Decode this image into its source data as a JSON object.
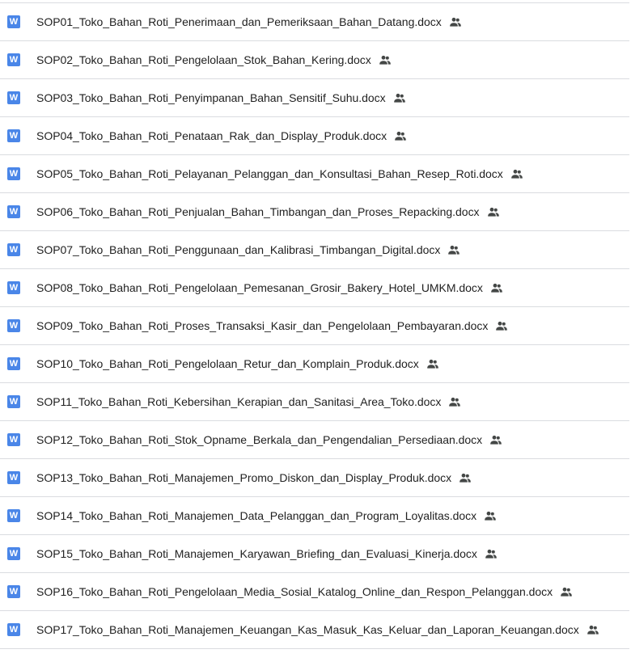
{
  "files": [
    {
      "name": "SOP01_Toko_Bahan_Roti_Penerimaan_dan_Pemeriksaan_Bahan_Datang.docx",
      "file_type_icon": "word-doc-icon",
      "shared_icon": "people-icon"
    },
    {
      "name": "SOP02_Toko_Bahan_Roti_Pengelolaan_Stok_Bahan_Kering.docx",
      "file_type_icon": "word-doc-icon",
      "shared_icon": "people-icon"
    },
    {
      "name": "SOP03_Toko_Bahan_Roti_Penyimpanan_Bahan_Sensitif_Suhu.docx",
      "file_type_icon": "word-doc-icon",
      "shared_icon": "people-icon"
    },
    {
      "name": "SOP04_Toko_Bahan_Roti_Penataan_Rak_dan_Display_Produk.docx",
      "file_type_icon": "word-doc-icon",
      "shared_icon": "people-icon"
    },
    {
      "name": "SOP05_Toko_Bahan_Roti_Pelayanan_Pelanggan_dan_Konsultasi_Bahan_Resep_Roti.docx",
      "file_type_icon": "word-doc-icon",
      "shared_icon": "people-icon"
    },
    {
      "name": "SOP06_Toko_Bahan_Roti_Penjualan_Bahan_Timbangan_dan_Proses_Repacking.docx",
      "file_type_icon": "word-doc-icon",
      "shared_icon": "people-icon"
    },
    {
      "name": "SOP07_Toko_Bahan_Roti_Penggunaan_dan_Kalibrasi_Timbangan_Digital.docx",
      "file_type_icon": "word-doc-icon",
      "shared_icon": "people-icon"
    },
    {
      "name": "SOP08_Toko_Bahan_Roti_Pengelolaan_Pemesanan_Grosir_Bakery_Hotel_UMKM.docx",
      "file_type_icon": "word-doc-icon",
      "shared_icon": "people-icon"
    },
    {
      "name": "SOP09_Toko_Bahan_Roti_Proses_Transaksi_Kasir_dan_Pengelolaan_Pembayaran.docx",
      "file_type_icon": "word-doc-icon",
      "shared_icon": "people-icon"
    },
    {
      "name": "SOP10_Toko_Bahan_Roti_Pengelolaan_Retur_dan_Komplain_Produk.docx",
      "file_type_icon": "word-doc-icon",
      "shared_icon": "people-icon"
    },
    {
      "name": "SOP11_Toko_Bahan_Roti_Kebersihan_Kerapian_dan_Sanitasi_Area_Toko.docx",
      "file_type_icon": "word-doc-icon",
      "shared_icon": "people-icon"
    },
    {
      "name": "SOP12_Toko_Bahan_Roti_Stok_Opname_Berkala_dan_Pengendalian_Persediaan.docx",
      "file_type_icon": "word-doc-icon",
      "shared_icon": "people-icon"
    },
    {
      "name": "SOP13_Toko_Bahan_Roti_Manajemen_Promo_Diskon_dan_Display_Produk.docx",
      "file_type_icon": "word-doc-icon",
      "shared_icon": "people-icon"
    },
    {
      "name": "SOP14_Toko_Bahan_Roti_Manajemen_Data_Pelanggan_dan_Program_Loyalitas.docx",
      "file_type_icon": "word-doc-icon",
      "shared_icon": "people-icon"
    },
    {
      "name": "SOP15_Toko_Bahan_Roti_Manajemen_Karyawan_Briefing_dan_Evaluasi_Kinerja.docx",
      "file_type_icon": "word-doc-icon",
      "shared_icon": "people-icon"
    },
    {
      "name": "SOP16_Toko_Bahan_Roti_Pengelolaan_Media_Sosial_Katalog_Online_dan_Respon_Pelanggan.docx",
      "file_type_icon": "word-doc-icon",
      "shared_icon": "people-icon"
    },
    {
      "name": "SOP17_Toko_Bahan_Roti_Manajemen_Keuangan_Kas_Masuk_Kas_Keluar_dan_Laporan_Keuangan.docx",
      "file_type_icon": "word-doc-icon",
      "shared_icon": "people-icon"
    }
  ],
  "icon_letter": "W",
  "colors": {
    "word_icon": "#4a86e8",
    "text": "#1f1f1f",
    "shared_icon": "#444746",
    "divider": "#dadce0"
  }
}
